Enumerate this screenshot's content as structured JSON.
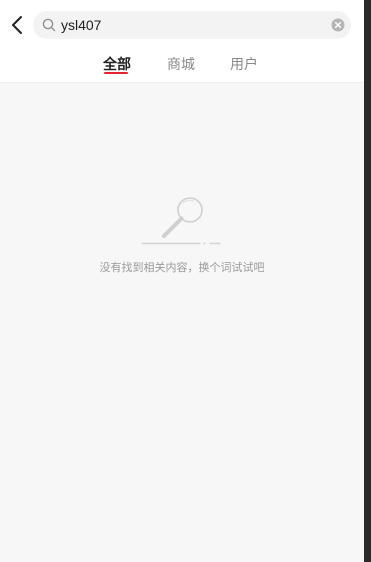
{
  "header": {
    "back_icon": "chevron-left-icon",
    "search": {
      "value": "ysl407",
      "placeholder": "",
      "search_icon": "search-icon",
      "clear_icon": "clear-circle-icon"
    }
  },
  "tabs": [
    {
      "label": "全部",
      "active": true
    },
    {
      "label": "商城",
      "active": false
    },
    {
      "label": "用户",
      "active": false
    }
  ],
  "empty_state": {
    "icon": "magnifier-illustration-icon",
    "message": "没有找到相关内容，换个词试试吧"
  },
  "colors": {
    "accent": "#e5242f",
    "background": "#f7f7f7",
    "header_bg": "#ffffff",
    "muted_text": "#9a9a9a"
  }
}
